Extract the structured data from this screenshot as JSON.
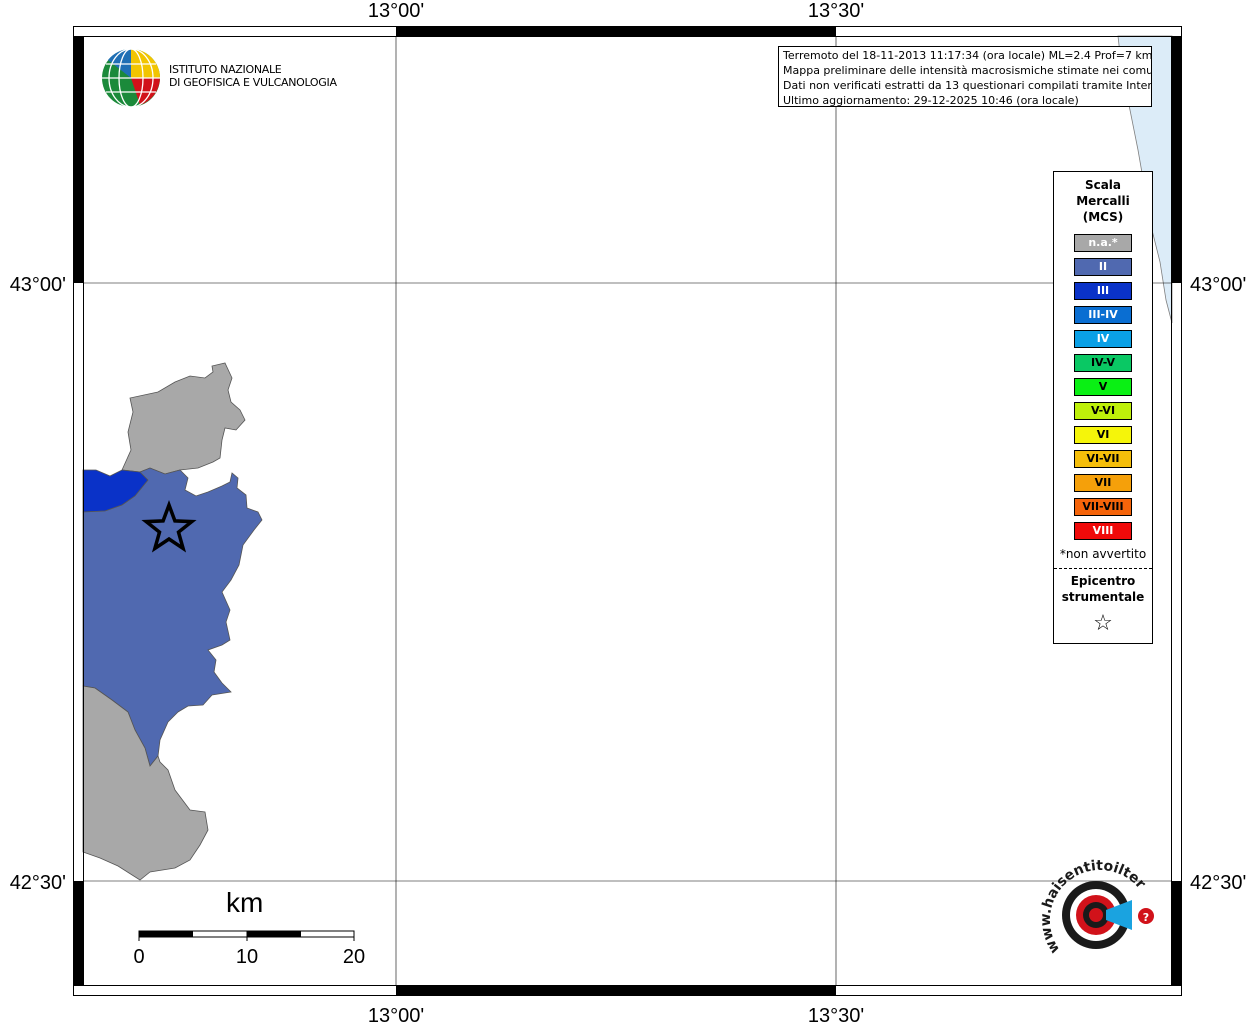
{
  "coordinates": {
    "top_lon_1": "13°00'",
    "top_lon_2": "13°30'",
    "bottom_lon_1": "13°00'",
    "bottom_lon_2": "13°30'",
    "left_lat_1": "43°00'",
    "left_lat_2": "42°30'",
    "right_lat_1": "43°00'",
    "right_lat_2": "42°30'"
  },
  "logo": {
    "line1": "ISTITUTO NAZIONALE",
    "line2": "DI GEOFISICA E VULCANOLOGIA",
    "icon": "ingv-globe-logo"
  },
  "info": {
    "line1": "Terremoto del 18-11-2013 11:17:34 (ora locale) ML=2.4 Prof=7 km",
    "line2": "Mappa preliminare delle intensità macrosismiche stimate nei comuni",
    "line3": "Dati non verificati estratti da 13 questionari compilati tramite Internet.",
    "line4": "Ultimo aggiornamento: 29-12-2025 10:46 (ora locale)"
  },
  "legend": {
    "title1": "Scala",
    "title2": "Mercalli",
    "title3": "(MCS)",
    "items": [
      {
        "label": "n.a.*",
        "color": "#a8a8a8",
        "text_color": "#ffffff"
      },
      {
        "label": "II",
        "color": "#5069b0",
        "text_color": "#ffffff"
      },
      {
        "label": "III",
        "color": "#0a32c8",
        "text_color": "#ffffff"
      },
      {
        "label": "III-IV",
        "color": "#0a6ed2",
        "text_color": "#ffffff"
      },
      {
        "label": "IV",
        "color": "#0aa0e6",
        "text_color": "#ffffff"
      },
      {
        "label": "IV-V",
        "color": "#0ac864",
        "text_color": "#000000"
      },
      {
        "label": "V",
        "color": "#0af014",
        "text_color": "#000000"
      },
      {
        "label": "V-VI",
        "color": "#bef00a",
        "text_color": "#000000"
      },
      {
        "label": "VI",
        "color": "#f5f50a",
        "text_color": "#000000"
      },
      {
        "label": "VI-VII",
        "color": "#f5be0a",
        "text_color": "#000000"
      },
      {
        "label": "VII",
        "color": "#f5a00a",
        "text_color": "#000000"
      },
      {
        "label": "VII-VIII",
        "color": "#f5640a",
        "text_color": "#000000"
      },
      {
        "label": "VIII",
        "color": "#f00a0a",
        "text_color": "#ffffff"
      }
    ],
    "note": "*non avvertito",
    "epicenter1": "Epicentro",
    "epicenter2": "strumentale",
    "epicenter_icon": "star-icon"
  },
  "scale_bar": {
    "unit": "km",
    "ticks": [
      "0",
      "10",
      "20"
    ]
  },
  "watermark": {
    "text": "www.haisentitoilterremoto.it",
    "icon": "hai-sentito-il-terremoto-logo"
  },
  "colors": {
    "sea": "#dcecf8",
    "not_felt": "#a8a8a8",
    "intensity_II": "#5069b0",
    "intensity_III": "#0a32c8"
  }
}
